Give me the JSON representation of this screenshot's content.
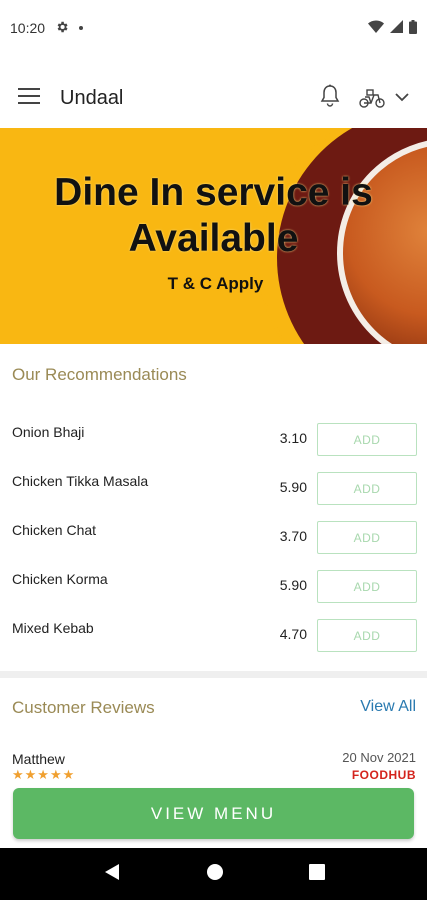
{
  "status_bar": {
    "time": "10:20"
  },
  "app_bar": {
    "title": "Undaal"
  },
  "banner": {
    "title_line1": "Dine In service is",
    "title_line2": "Available",
    "subtitle": "T & C Apply"
  },
  "recommendations": {
    "heading": "Our Recommendations",
    "items": [
      {
        "name": "Onion Bhaji",
        "price": "3.10",
        "add_label": "ADD"
      },
      {
        "name": "Chicken Tikka Masala",
        "price": "5.90",
        "add_label": "ADD"
      },
      {
        "name": "Chicken Chat",
        "price": "3.70",
        "add_label": "ADD"
      },
      {
        "name": "Chicken Korma",
        "price": "5.90",
        "add_label": "ADD"
      },
      {
        "name": "Mixed Kebab",
        "price": "4.70",
        "add_label": "ADD"
      }
    ]
  },
  "reviews": {
    "heading": "Customer Reviews",
    "view_all_label": "View All",
    "first": {
      "author": "Matthew",
      "date": "20 Nov 2021",
      "stars": "★★★★★",
      "rating": 5,
      "source": "FOODHUB"
    }
  },
  "view_menu_label": "VIEW MENU",
  "colors": {
    "banner_yellow": "#f9b712",
    "accent_green": "#5cb864",
    "link_blue": "#2a7ab0",
    "heading_olive": "#9a8a55"
  },
  "icons": [
    "settings-icon",
    "wifi-icon",
    "signal-icon",
    "battery-icon",
    "hamburger-menu-icon",
    "bell-icon",
    "delivery-scooter-icon",
    "chevron-down-icon",
    "back-icon",
    "home-icon",
    "recents-icon"
  ]
}
